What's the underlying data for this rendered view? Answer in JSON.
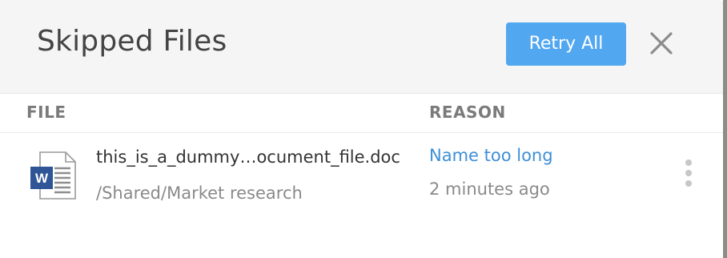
{
  "dialog": {
    "title": "Skipped Files",
    "retry_label": "Retry All",
    "close_icon": "close-icon"
  },
  "table": {
    "headers": {
      "file": "FILE",
      "reason": "REASON"
    },
    "rows": [
      {
        "name": "this_is_a_dummy…ocument_file.doc",
        "path": "/Shared/Market research",
        "reason": "Name too long",
        "time": "2 minutes ago",
        "icon": "word-document-icon",
        "icon_badge": "W",
        "more_icon": "more-vertical-icon"
      }
    ]
  },
  "colors": {
    "primary": "#52a7f1",
    "link": "#3d8fd7",
    "header_bg": "#f5f5f5",
    "word_blue": "#2f5597"
  }
}
